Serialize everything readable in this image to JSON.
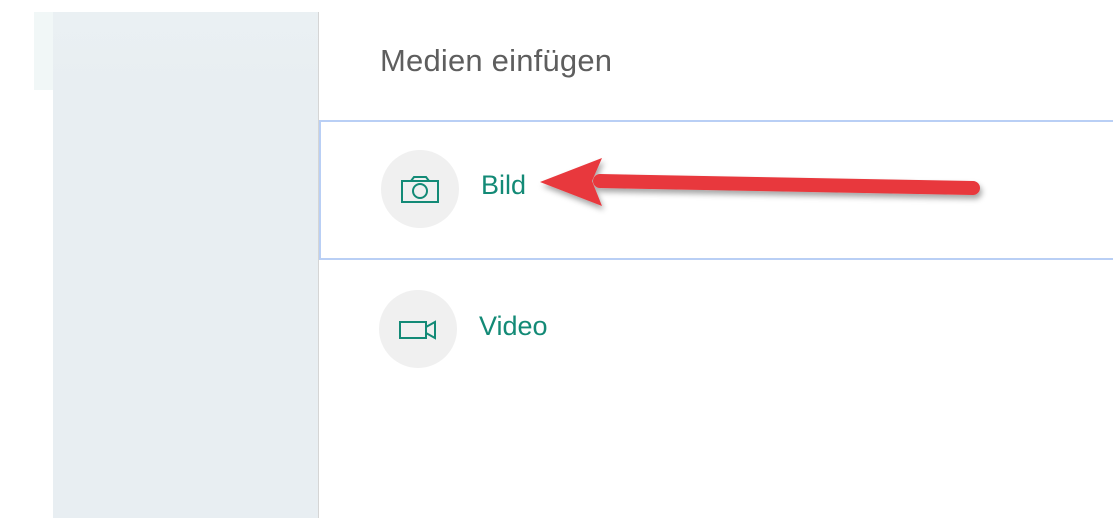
{
  "panel": {
    "title": "Medien einfügen"
  },
  "options": [
    {
      "label": "Bild",
      "icon": "camera-icon",
      "selected": true
    },
    {
      "label": "Video",
      "icon": "video-camera-icon",
      "selected": false
    }
  ],
  "colors": {
    "accent": "#138a76",
    "selection_border": "#b9cff5",
    "sidebar": "#e8eef2",
    "icon_circle": "#f0f0f0",
    "annotation_arrow": "#e8383d"
  }
}
